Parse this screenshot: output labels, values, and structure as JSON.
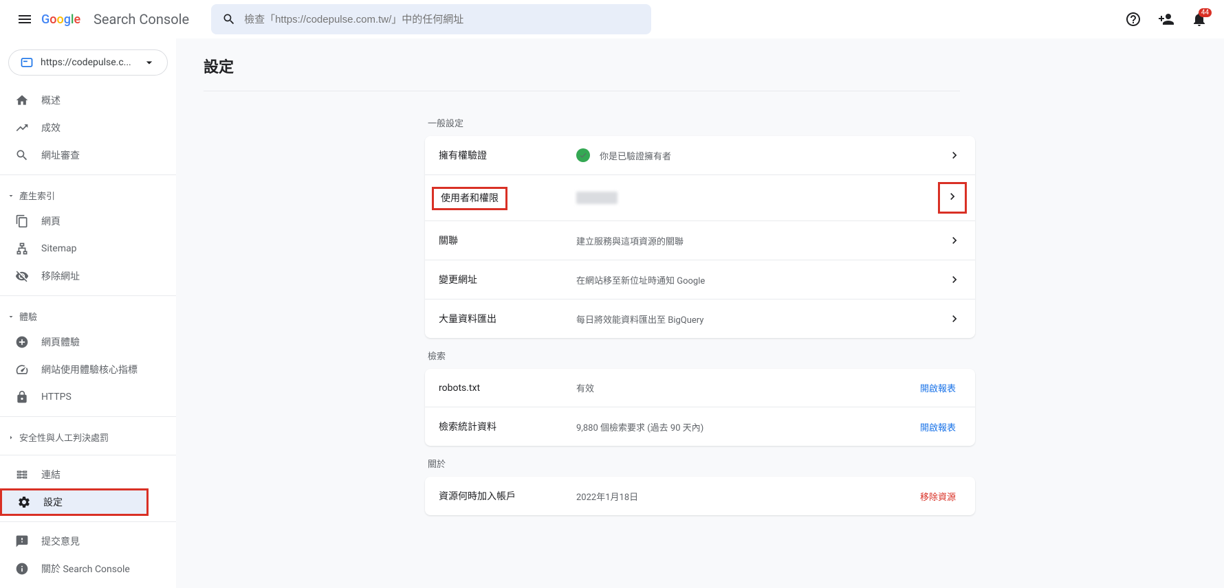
{
  "header": {
    "search_placeholder": "檢查「https://codepulse.com.tw/」中的任何網址",
    "badge_count": "44",
    "product_name": "Search Console"
  },
  "sidebar": {
    "property": "https://codepulse.c...",
    "items": {
      "overview": "概述",
      "performance": "成效",
      "url_inspection": "網址審查"
    },
    "section_indexing": "產生索引",
    "indexing": {
      "pages": "網頁",
      "sitemaps": "Sitemap",
      "removals": "移除網址"
    },
    "section_experience": "體驗",
    "experience": {
      "page_experience": "網頁體驗",
      "cwv": "網站使用體驗核心指標",
      "https": "HTTPS"
    },
    "section_security": "安全性與人工判決處罰",
    "links": "連結",
    "settings": "設定",
    "feedback": "提交意見",
    "about": "關於 Search Console"
  },
  "page": {
    "title": "設定",
    "sections": {
      "general": "一般設定",
      "crawling": "檢索",
      "about": "關於"
    },
    "general_rows": {
      "ownership": {
        "title": "擁有權驗證",
        "desc": "你是已驗證擁有者"
      },
      "users": {
        "title": "使用者和權限"
      },
      "associations": {
        "title": "關聯",
        "desc": "建立服務與這項資源的關聯"
      },
      "change_address": {
        "title": "變更網址",
        "desc": "在網站移至新位址時通知 Google"
      },
      "bulk_export": {
        "title": "大量資料匯出",
        "desc": "每日將效能資料匯出至 BigQuery"
      }
    },
    "crawl_rows": {
      "robots": {
        "title": "robots.txt",
        "desc": "有效",
        "action": "開啟報表"
      },
      "stats": {
        "title": "檢索統計資料",
        "desc": "9,880 個檢索要求 (過去 90 天內)",
        "action": "開啟報表"
      }
    },
    "about_rows": {
      "added": {
        "title": "資源何時加入帳戶",
        "desc": "2022年1月18日",
        "action": "移除資源"
      }
    }
  }
}
